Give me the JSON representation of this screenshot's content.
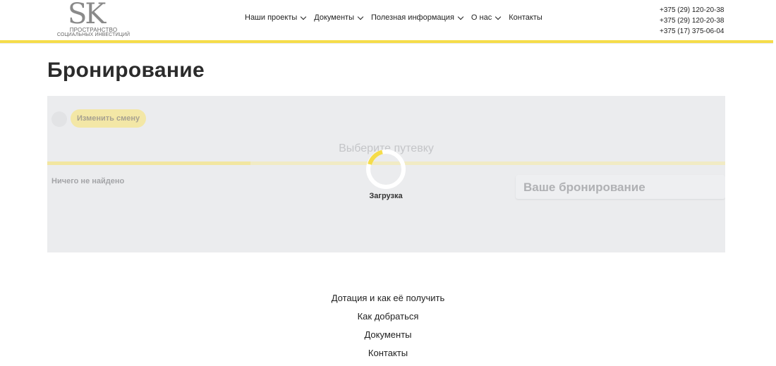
{
  "logo": {
    "mark": "SK",
    "line1": "ПРОСТРАНСТВО",
    "line2": "СОЦИАЛЬНЫХ ИНВЕСТИЦИЙ"
  },
  "nav": {
    "items": [
      {
        "label": "Наши проекты",
        "dropdown": true
      },
      {
        "label": "Документы",
        "dropdown": true
      },
      {
        "label": "Полезная информация",
        "dropdown": true
      },
      {
        "label": "О нас",
        "dropdown": true
      },
      {
        "label": "Контакты",
        "dropdown": false
      }
    ]
  },
  "phones": [
    "+375 (29) 120-20-38",
    "+375 (29) 120-20-38",
    "+375 (17) 375-06-04"
  ],
  "page": {
    "title": "Бронирование"
  },
  "booking": {
    "change_shift_label": "Изменить смену",
    "choose_text": "Выберите путевку",
    "progress": 0.3,
    "nothing_found": "Ничего не найдено",
    "your_booking": "Ваше бронирование"
  },
  "loader": {
    "label": "Загрузка"
  },
  "footer": {
    "links": [
      "Дотация и как её получить",
      "Как добраться",
      "Документы",
      "Контакты"
    ]
  },
  "colors": {
    "accent": "#f5dc4a",
    "panel_bg": "#ebecee"
  }
}
